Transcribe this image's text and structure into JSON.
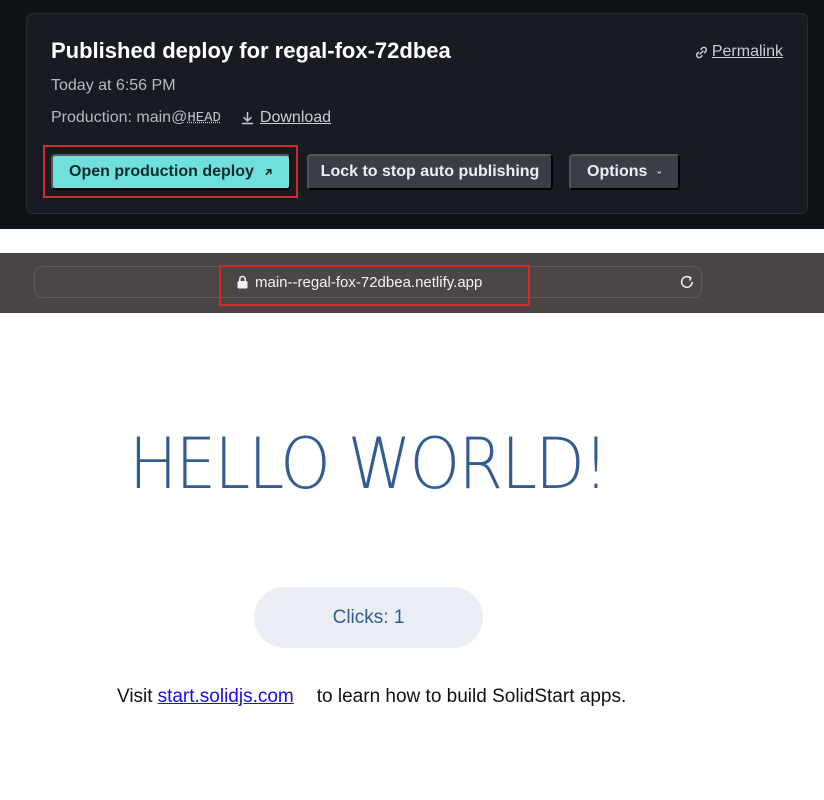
{
  "deploy": {
    "title": "Published deploy for regal-fox-72dbea",
    "permalink_label": "Permalink",
    "time": "Today at 6:56 PM",
    "branch_prefix": "Production: main@",
    "branch_ref": "HEAD",
    "download_label": "Download",
    "buttons": {
      "open_production": "Open production deploy",
      "lock": "Lock to stop auto publishing",
      "options": "Options"
    },
    "accent_color": "#6fe0db"
  },
  "browser": {
    "url": "main--regal-fox-72dbea.netlify.app"
  },
  "page": {
    "heading": "HELLO WORLD!",
    "counter_label": "Clicks: 1",
    "visit_prefix": "Visit",
    "visit_link": "start.solidjs.com",
    "visit_suffix": "to learn how to build SolidStart apps."
  },
  "annotations": {
    "highlight_color": "#d42a2a"
  }
}
